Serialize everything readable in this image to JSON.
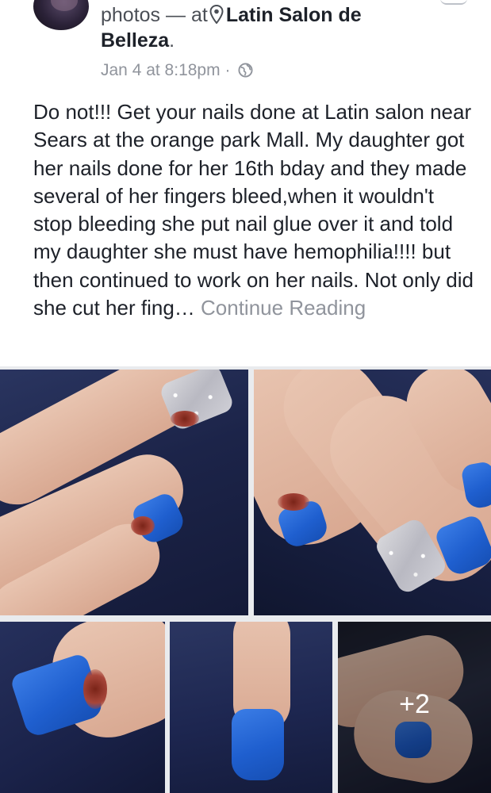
{
  "post": {
    "header_prefix": "photos — at",
    "place_part1": "Latin Salon de",
    "place_part2": "Belleza",
    "timestamp": "Jan 4 at 8:18pm",
    "separator": "·",
    "body_text": "Do not!!! Get your nails done at Latin salon near Sears at the orange park Mall. My daughter got her nails done for her 16th bday and they made several of her fingers bleed,when it wouldn't stop bleeding she put nail glue over it and told my daughter she must have hemophilia!!!! but then continued to work on her nails. Not only did she cut her fing…",
    "continue_label": "Continue Reading"
  },
  "photos": {
    "more_count_label": "+2"
  },
  "icons": {
    "location": "map-pin-icon",
    "audience": "globe-icon"
  },
  "colors": {
    "text_primary": "#1d2129",
    "text_secondary": "#90949c",
    "page_bg": "#e9ebee",
    "card_bg": "#ffffff"
  }
}
